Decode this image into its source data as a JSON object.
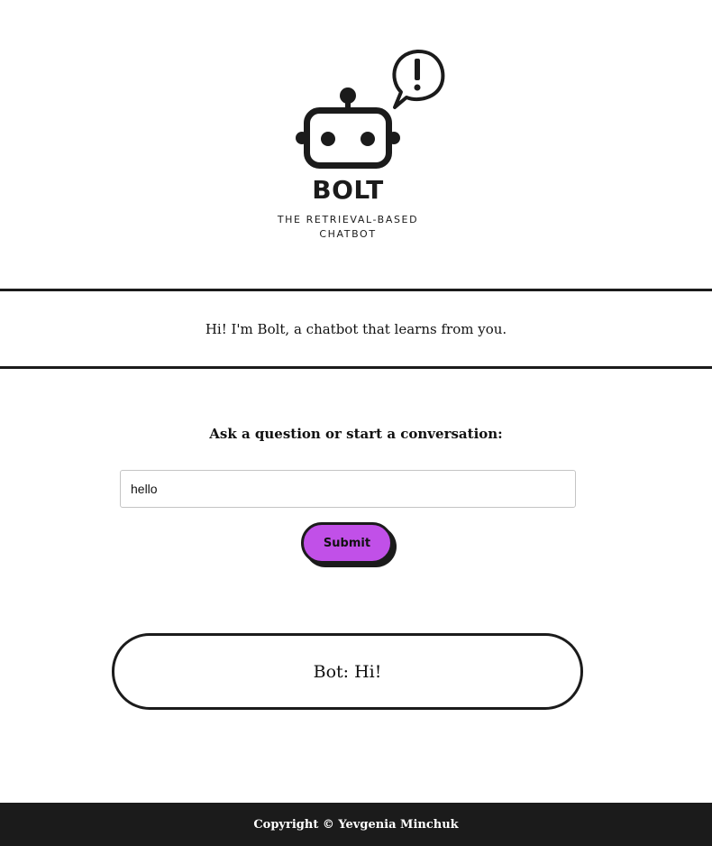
{
  "logo": {
    "icon": "robot-icon",
    "alert_icon": "speech-bubble-exclamation-icon",
    "title": "BOLT",
    "subtitle_line1": "THE RETRIEVAL-BASED",
    "subtitle_line2": "CHATBOT"
  },
  "intro": {
    "text": "Hi! I'm Bolt, a chatbot that learns from you."
  },
  "form": {
    "prompt": "Ask a question or start a conversation:",
    "input_value": "hello",
    "submit_label": "Submit"
  },
  "response": {
    "text": "Bot: Hi!"
  },
  "footer": {
    "text": "Copyright © Yevgenia Minchuk"
  },
  "colors": {
    "accent": "#c150e8",
    "dark": "#1b1b1b",
    "background": "#ffffff"
  }
}
